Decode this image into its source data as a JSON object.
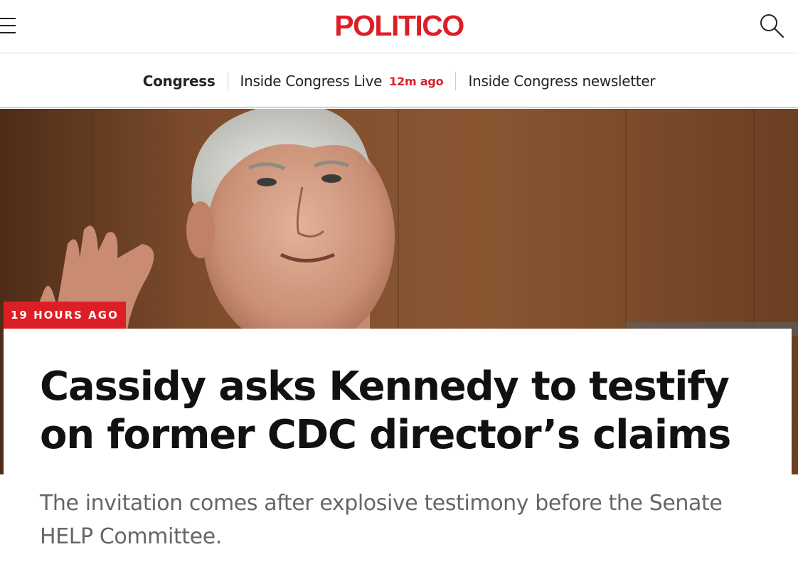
{
  "header": {
    "logo_text": "POLITICO",
    "brand_color": "#dc1f26",
    "menu_icon": "hamburger-menu-icon",
    "search_icon": "search-icon"
  },
  "subnav": {
    "section_label": "Congress",
    "live_label": "Inside Congress Live",
    "live_timestamp": "12m ago",
    "newsletter_label": "Inside Congress newsletter"
  },
  "article": {
    "timestamp_badge": "19 HOURS AGO",
    "headline": "Cassidy asks Kennedy to testify on former CDC director’s claims",
    "dek": "The invitation comes after explosive testimony before the Senate HELP Committee."
  }
}
